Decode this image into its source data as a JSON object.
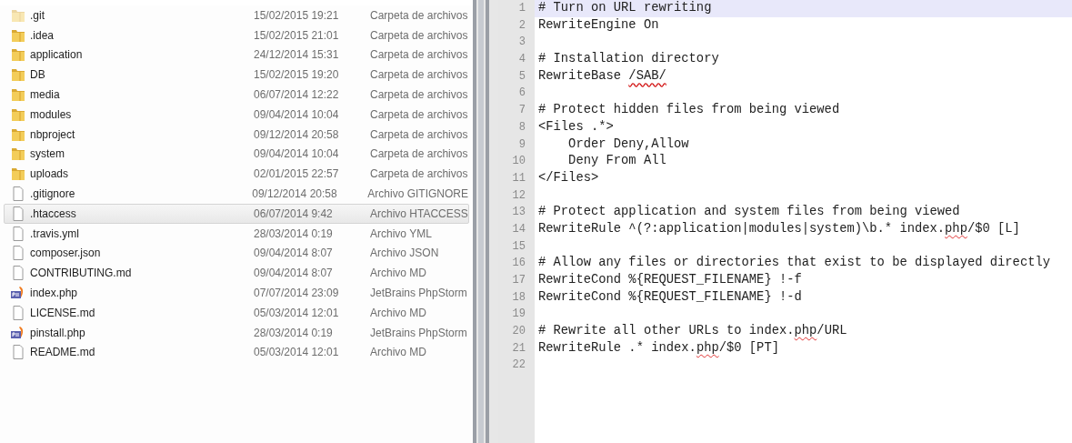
{
  "files": [
    {
      "name": ".git",
      "date": "15/02/2015 19:21",
      "type": "Carpeta de archivos",
      "kind": "folder",
      "hidden": true,
      "selected": false
    },
    {
      "name": ".idea",
      "date": "15/02/2015 21:01",
      "type": "Carpeta de archivos",
      "kind": "folder",
      "hidden": false,
      "selected": false
    },
    {
      "name": "application",
      "date": "24/12/2014 15:31",
      "type": "Carpeta de archivos",
      "kind": "folder",
      "hidden": false,
      "selected": false
    },
    {
      "name": "DB",
      "date": "15/02/2015 19:20",
      "type": "Carpeta de archivos",
      "kind": "folder",
      "hidden": false,
      "selected": false
    },
    {
      "name": "media",
      "date": "06/07/2014 12:22",
      "type": "Carpeta de archivos",
      "kind": "folder",
      "hidden": false,
      "selected": false
    },
    {
      "name": "modules",
      "date": "09/04/2014 10:04",
      "type": "Carpeta de archivos",
      "kind": "folder",
      "hidden": false,
      "selected": false
    },
    {
      "name": "nbproject",
      "date": "09/12/2014 20:58",
      "type": "Carpeta de archivos",
      "kind": "folder",
      "hidden": false,
      "selected": false
    },
    {
      "name": "system",
      "date": "09/04/2014 10:04",
      "type": "Carpeta de archivos",
      "kind": "folder",
      "hidden": false,
      "selected": false
    },
    {
      "name": "uploads",
      "date": "02/01/2015 22:57",
      "type": "Carpeta de archivos",
      "kind": "folder",
      "hidden": false,
      "selected": false
    },
    {
      "name": ".gitignore",
      "date": "09/12/2014 20:58",
      "type": "Archivo GITIGNORE",
      "kind": "file",
      "hidden": false,
      "selected": false
    },
    {
      "name": ".htaccess",
      "date": "06/07/2014 9:42",
      "type": "Archivo HTACCESS",
      "kind": "file",
      "hidden": false,
      "selected": true
    },
    {
      "name": ".travis.yml",
      "date": "28/03/2014 0:19",
      "type": "Archivo YML",
      "kind": "file",
      "hidden": false,
      "selected": false
    },
    {
      "name": "composer.json",
      "date": "09/04/2014 8:07",
      "type": "Archivo JSON",
      "kind": "file",
      "hidden": false,
      "selected": false
    },
    {
      "name": "CONTRIBUTING.md",
      "date": "09/04/2014 8:07",
      "type": "Archivo MD",
      "kind": "file",
      "hidden": false,
      "selected": false
    },
    {
      "name": "index.php",
      "date": "07/07/2014 23:09",
      "type": "JetBrains PhpStorm",
      "kind": "php",
      "hidden": false,
      "selected": false
    },
    {
      "name": "LICENSE.md",
      "date": "05/03/2014 12:01",
      "type": "Archivo MD",
      "kind": "file",
      "hidden": false,
      "selected": false
    },
    {
      "name": "pinstall.php",
      "date": "28/03/2014 0:19",
      "type": "JetBrains PhpStorm",
      "kind": "php",
      "hidden": false,
      "selected": false
    },
    {
      "name": "README.md",
      "date": "05/03/2014 12:01",
      "type": "Archivo MD",
      "kind": "file",
      "hidden": false,
      "selected": false
    }
  ],
  "editor": {
    "lines": [
      {
        "number": "1",
        "current": true,
        "segments": [
          {
            "text": "# Turn on URL rewriting"
          }
        ]
      },
      {
        "number": "2",
        "current": false,
        "segments": [
          {
            "text": "RewriteEngine On"
          }
        ]
      },
      {
        "number": "3",
        "current": false
      },
      {
        "number": "4",
        "current": false,
        "segments": [
          {
            "text": "# Installation directory"
          }
        ]
      },
      {
        "number": "5",
        "current": false,
        "segments": [
          {
            "text": "RewriteBase "
          },
          {
            "text": "/SAB/",
            "annotated": true
          }
        ]
      },
      {
        "number": "6",
        "current": false
      },
      {
        "number": "7",
        "current": false,
        "segments": [
          {
            "text": "# Protect hidden files from being viewed"
          }
        ]
      },
      {
        "number": "8",
        "current": false,
        "segments": [
          {
            "text": "<Files .*>"
          }
        ]
      },
      {
        "number": "9",
        "current": false,
        "segments": [
          {
            "text": "    Order Deny,Allow"
          }
        ]
      },
      {
        "number": "10",
        "current": false,
        "segments": [
          {
            "text": "    Deny From All"
          }
        ]
      },
      {
        "number": "11",
        "current": false,
        "segments": [
          {
            "text": "</Files>"
          }
        ]
      },
      {
        "number": "12",
        "current": false
      },
      {
        "number": "13",
        "current": false,
        "segments": [
          {
            "text": "# Protect application and system files from being viewed"
          }
        ]
      },
      {
        "number": "14",
        "current": false,
        "segments": [
          {
            "text": "RewriteRule ^(?:application|modules|system)\\b.* index."
          },
          {
            "text": "php",
            "misspelled": true
          },
          {
            "text": "/$0 [L]"
          }
        ]
      },
      {
        "number": "15",
        "current": false
      },
      {
        "number": "16",
        "current": false,
        "segments": [
          {
            "text": "# Allow any files or directories that exist to be displayed directly"
          }
        ]
      },
      {
        "number": "17",
        "current": false,
        "segments": [
          {
            "text": "RewriteCond %{REQUEST_FILENAME} !-f"
          }
        ]
      },
      {
        "number": "18",
        "current": false,
        "segments": [
          {
            "text": "RewriteCond %{REQUEST_FILENAME} !-d"
          }
        ]
      },
      {
        "number": "19",
        "current": false
      },
      {
        "number": "20",
        "current": false,
        "segments": [
          {
            "text": "# Rewrite all other URLs to index."
          },
          {
            "text": "php",
            "misspelled": true
          },
          {
            "text": "/URL"
          }
        ]
      },
      {
        "number": "21",
        "current": false,
        "segments": [
          {
            "text": "RewriteRule .* index."
          },
          {
            "text": "php",
            "misspelled": true
          },
          {
            "text": "/$0 [PT]"
          }
        ]
      },
      {
        "number": "22",
        "current": false
      }
    ]
  }
}
